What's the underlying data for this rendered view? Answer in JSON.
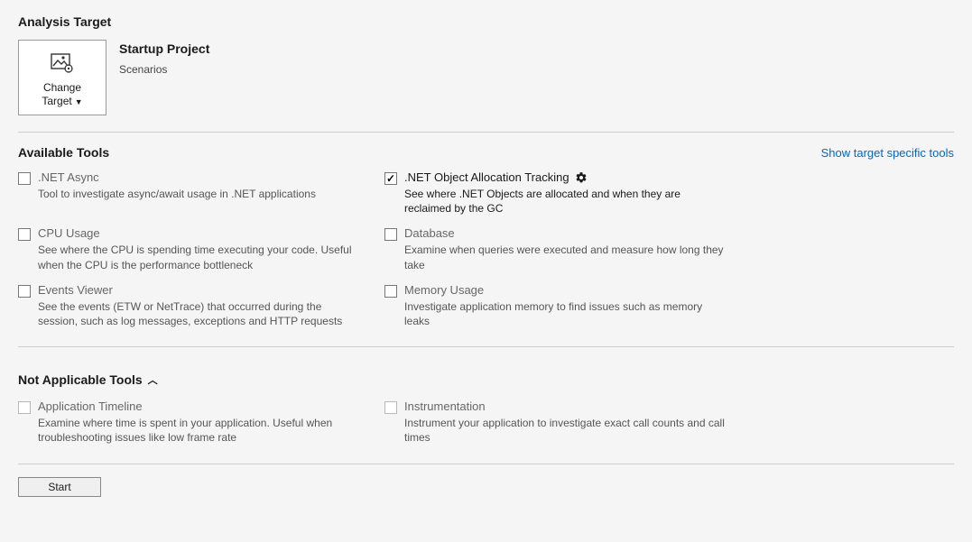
{
  "header": {
    "title": "Analysis Target",
    "change_target_line1": "Change",
    "change_target_line2": "Target",
    "project_title": "Startup Project",
    "project_sub": "Scenarios"
  },
  "available": {
    "title": "Available Tools",
    "link": "Show target specific tools",
    "items": [
      {
        "name": ".NET Async",
        "desc": "Tool to investigate async/await usage in .NET applications",
        "checked": false,
        "has_gear": false
      },
      {
        "name": ".NET Object Allocation Tracking",
        "desc": "See where .NET Objects are allocated and when they are reclaimed by the GC",
        "checked": true,
        "has_gear": true
      },
      {
        "name": "CPU Usage",
        "desc": "See where the CPU is spending time executing your code. Useful when the CPU is the performance bottleneck",
        "checked": false,
        "has_gear": false
      },
      {
        "name": "Database",
        "desc": "Examine when queries were executed and measure how long they take",
        "checked": false,
        "has_gear": false
      },
      {
        "name": "Events Viewer",
        "desc": "See the events (ETW or NetTrace) that occurred during the session, such as log messages, exceptions and HTTP requests",
        "checked": false,
        "has_gear": false
      },
      {
        "name": "Memory Usage",
        "desc": "Investigate application memory to find issues such as memory leaks",
        "checked": false,
        "has_gear": false
      }
    ]
  },
  "not_applicable": {
    "title": "Not Applicable Tools",
    "items": [
      {
        "name": "Application Timeline",
        "desc": "Examine where time is spent in your application. Useful when troubleshooting issues like low frame rate"
      },
      {
        "name": "Instrumentation",
        "desc": "Instrument your application to investigate exact call counts and call times"
      }
    ]
  },
  "footer": {
    "start": "Start"
  }
}
